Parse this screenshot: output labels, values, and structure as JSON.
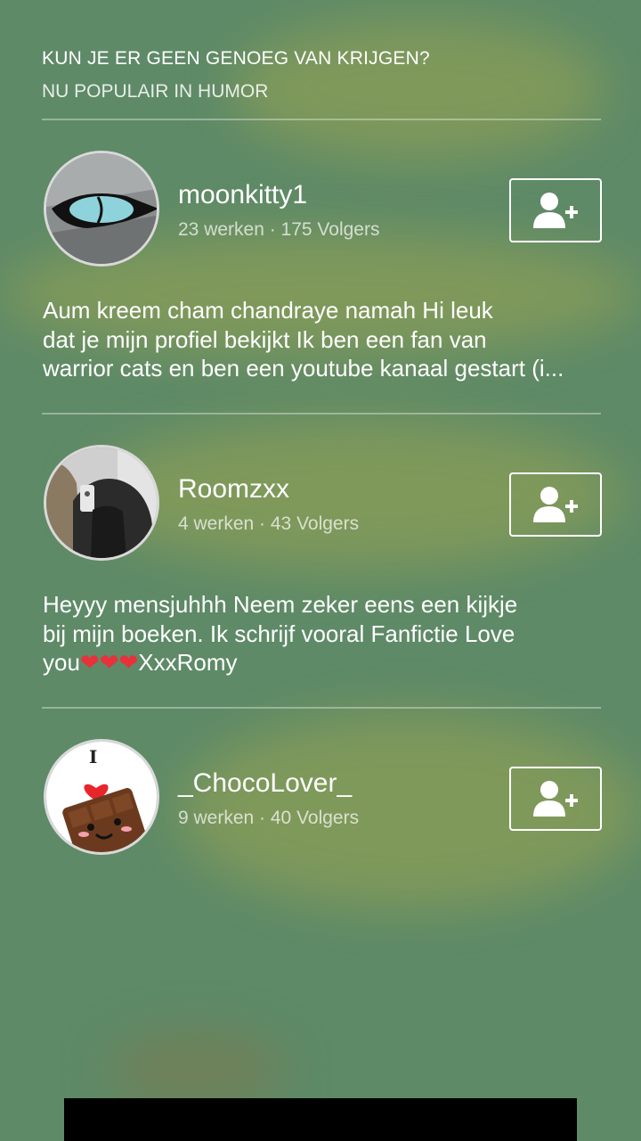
{
  "header": {
    "title": "KUN JE ER GEEN GENOEG VAN KRIJGEN?",
    "subtitle": "NU POPULAIR IN HUMOR"
  },
  "users": [
    {
      "username": "moonkitty1",
      "stats": "23 werken · 175 Volgers",
      "bio_lines": [
        "Aum kreem cham chandraye namah Hi leuk",
        "dat je mijn profiel bekijkt Ik ben een fan van",
        "warrior cats en ben een youtube kanaal gestart (i..."
      ],
      "avatar_icon": "cat-eye-avatar",
      "follow_icon": "add-user-icon"
    },
    {
      "username": "Roomzxx",
      "stats": "4 werken · 43 Volgers",
      "bio_lines": [
        "Heyyy mensjuhhh Neem zeker eens een kijkje",
        "bij mijn boeken. Ik schrijf vooral Fanfictie Love",
        "you",
        "XxxRomy"
      ],
      "bio_hearts": "❤❤❤",
      "avatar_icon": "selfie-photo-avatar",
      "follow_icon": "add-user-icon"
    },
    {
      "username": "_ChocoLover_",
      "stats": "9 werken · 40 Volgers",
      "avatar_icon": "chocolate-heart-avatar",
      "avatar_text": "I",
      "follow_icon": "add-user-icon"
    }
  ],
  "colors": {
    "background": "#5e8a67",
    "text": "#ffffff",
    "heart": "#e8313a"
  }
}
